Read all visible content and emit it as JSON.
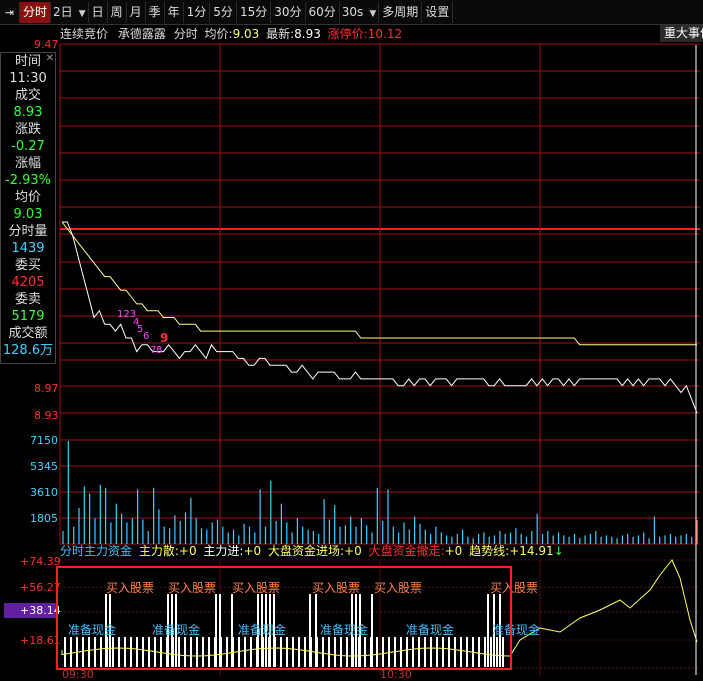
{
  "toolbar": {
    "pin": "⇥",
    "items": [
      "分时",
      "2日",
      "日",
      "周",
      "月",
      "季",
      "年",
      "1分",
      "5分",
      "15分",
      "30分",
      "60分",
      "30s",
      "多周期",
      "设置"
    ]
  },
  "header": {
    "section": "连续竞价",
    "stock": "承德露露",
    "mode": "分时",
    "avg_label": "均价:",
    "avg_value": "9.03",
    "last_label": "最新:",
    "last_value": "8.93",
    "limit_label": "涨停价:",
    "limit_value": "10.12",
    "news_button": "重大事件"
  },
  "info": {
    "close": "✕",
    "time_label": "时间",
    "time_value": "11:30",
    "deal_label": "成交",
    "deal_value": "8.93",
    "change_label": "涨跌",
    "change_value": "-0.27",
    "pct_label": "涨幅",
    "pct_value": "-2.93%",
    "avg_label": "均价",
    "avg_value": "9.03",
    "vol_label": "分时量",
    "vol_value": "1439",
    "bid_label": "委买",
    "bid_value": "4205",
    "ask_label": "委卖",
    "ask_value": "5179",
    "amount_label": "成交额",
    "amount_value": "128.6万"
  },
  "price_axis": [
    "9.47",
    "8.97",
    "8.93"
  ],
  "volume_axis": [
    "7150",
    "5345",
    "3610",
    "1805"
  ],
  "sub": {
    "title": "分时主力资金",
    "main_scatter_label": "主力散:",
    "main_scatter_value": "+0",
    "main_in_label": "主力进:",
    "main_in_value": "+0",
    "market_in_label": "大盘资金进场:",
    "market_in_value": "+0",
    "market_out_label": "大盘资金撤走:",
    "market_out_value": "+0",
    "trend_label": "趋势线:",
    "trend_value": "+14.91",
    "trend_arrow": "↓",
    "axis": [
      "+74.39",
      "+56.27",
      "+38.14",
      "+18.61"
    ],
    "buy_label": "买入股票",
    "cash_label": "准备现金"
  },
  "time_axis": [
    "09:30",
    "10:30"
  ],
  "wave_labels": [
    "123",
    "4",
    "5",
    "6",
    "7",
    "8",
    "9"
  ],
  "colors": {
    "up": "#ff3030",
    "down": "#30ff30",
    "grid": "#a01010",
    "price_line": "#ffffff",
    "avg_line": "#ffff80",
    "volume": "#40d0ff",
    "active_tab": "#8a1010",
    "cyan_label": "#40c0ff",
    "orange_label": "#ff8040",
    "magenta": "#ff40ff"
  },
  "chart_data": {
    "type": "line",
    "series": [
      {
        "values": [
          9.21,
          9.21,
          9.19,
          9.16,
          9.13,
          9.1,
          9.07,
          9.08,
          9.06,
          9.06,
          9.05,
          9.06,
          9.04,
          9.04,
          9.02,
          9.03,
          9.03,
          9.02,
          9.02,
          9.02,
          9.03,
          9.02,
          9.01,
          9.02,
          9.02,
          9.03,
          9.02,
          9.01,
          9.03,
          9.02,
          9.02,
          9.02,
          9.02,
          9.01,
          9.01,
          9.0,
          9.0,
          9.01,
          9.01,
          9.0,
          9.0,
          9.0,
          9.0,
          8.99,
          8.99,
          9.0,
          8.99,
          8.98,
          8.99,
          8.99,
          8.99,
          8.99,
          8.98,
          8.98,
          8.98,
          8.99,
          8.98,
          8.98,
          8.98,
          8.98,
          8.98,
          8.98,
          8.98,
          8.97,
          8.97,
          8.98,
          8.97,
          8.98,
          8.98,
          8.97,
          8.98,
          8.98,
          8.98,
          8.97,
          8.98,
          8.98,
          8.98,
          8.98,
          8.98,
          8.98,
          8.97,
          8.97,
          8.98,
          8.97,
          8.97,
          8.97,
          8.97,
          8.97,
          8.98,
          8.97,
          8.98,
          8.97,
          8.98,
          8.98,
          8.97,
          8.98,
          8.97,
          8.98,
          8.98,
          8.98,
          8.98,
          8.98,
          8.98,
          8.98,
          8.98,
          8.97,
          8.98,
          8.97,
          8.98,
          8.97,
          8.98,
          8.98,
          8.98,
          8.97,
          8.98,
          8.97,
          8.96,
          8.97,
          8.95,
          8.93
        ]
      },
      {
        "values": [
          9.21,
          9.2,
          9.19,
          9.18,
          9.17,
          9.16,
          9.15,
          9.14,
          9.13,
          9.13,
          9.12,
          9.11,
          9.11,
          9.1,
          9.09,
          9.09,
          9.08,
          9.08,
          9.08,
          9.07,
          9.07,
          9.07,
          9.06,
          9.06,
          9.06,
          9.06,
          9.05,
          9.05,
          9.05,
          9.05,
          9.05,
          9.05,
          9.05,
          9.05,
          9.05,
          9.05,
          9.05,
          9.05,
          9.05,
          9.05,
          9.05,
          9.05,
          9.05,
          9.05,
          9.05,
          9.05,
          9.05,
          9.05,
          9.05,
          9.05,
          9.05,
          9.05,
          9.05,
          9.05,
          9.05,
          9.05,
          9.04,
          9.04,
          9.04,
          9.04,
          9.04,
          9.04,
          9.04,
          9.04,
          9.04,
          9.04,
          9.04,
          9.04,
          9.04,
          9.04,
          9.04,
          9.04,
          9.04,
          9.04,
          9.04,
          9.04,
          9.04,
          9.04,
          9.04,
          9.04,
          9.04,
          9.04,
          9.04,
          9.04,
          9.04,
          9.04,
          9.04,
          9.04,
          9.04,
          9.04,
          9.04,
          9.04,
          9.04,
          9.04,
          9.04,
          9.04,
          9.04,
          9.03,
          9.03,
          9.03,
          9.03,
          9.03,
          9.03,
          9.03,
          9.03,
          9.03,
          9.03,
          9.03,
          9.03,
          9.03,
          9.03,
          9.03,
          9.03,
          9.03,
          9.03,
          9.03,
          9.03,
          9.03,
          9.03,
          9.03
        ]
      }
    ],
    "volume": [
      900,
      7150,
      1200,
      2500,
      4000,
      3500,
      1800,
      4100,
      3900,
      1500,
      2800,
      2100,
      1500,
      1800,
      3800,
      1700,
      900,
      3900,
      2400,
      1200,
      1100,
      2000,
      1600,
      2200,
      3200,
      1800,
      1100,
      1000,
      1500,
      1700,
      1200,
      800,
      1000,
      600,
      1400,
      1200,
      800,
      3800,
      1200,
      4400,
      1600,
      2800,
      1500,
      800,
      1800,
      1200,
      1000,
      900,
      700,
      3100,
      1700,
      2700,
      1200,
      1300,
      1900,
      1200,
      1800,
      1300,
      800,
      3900,
      1600,
      3800,
      1200,
      800,
      1500,
      1000,
      1900,
      1400,
      1000,
      700,
      1200,
      800,
      600,
      500,
      700,
      1000,
      500,
      400,
      700,
      800,
      500,
      600,
      900,
      700,
      800,
      1100,
      700,
      500,
      900,
      2100,
      700,
      900,
      600,
      800,
      600,
      500,
      700,
      400,
      600,
      700,
      900,
      500,
      600,
      500,
      400,
      600,
      700,
      500,
      600,
      800,
      400,
      1900,
      500,
      600,
      700,
      500,
      600,
      700,
      500,
      1400
    ],
    "ylim": [
      8.93,
      9.47
    ],
    "xlim": [
      "09:30",
      "11:30"
    ]
  }
}
